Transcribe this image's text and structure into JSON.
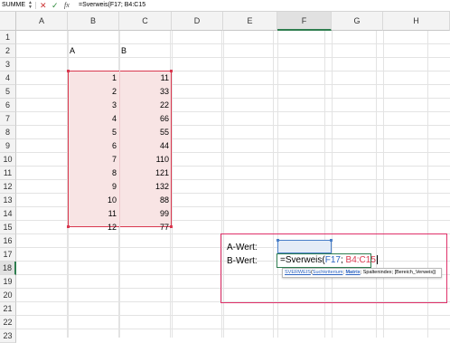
{
  "formula_bar": {
    "name_box": "SUMME",
    "cancel_icon": "x-icon",
    "enter_icon": "check-icon",
    "fx_label": "fx",
    "content": "=Sverweis(F17; B4:C15"
  },
  "columns": [
    "A",
    "B",
    "C",
    "D",
    "E",
    "F",
    "G",
    "H"
  ],
  "active_column": "F",
  "rows": [
    "1",
    "2",
    "3",
    "4",
    "5",
    "6",
    "7",
    "8",
    "9",
    "10",
    "11",
    "12",
    "13",
    "14",
    "15",
    "16",
    "17",
    "18",
    "19",
    "20",
    "21",
    "22",
    "23"
  ],
  "active_row": "18",
  "headers": {
    "b2": "A",
    "c2": "B"
  },
  "table": {
    "b": [
      "1",
      "2",
      "3",
      "4",
      "5",
      "6",
      "7",
      "8",
      "9",
      "10",
      "11",
      "12"
    ],
    "c": [
      "11",
      "33",
      "22",
      "66",
      "55",
      "44",
      "110",
      "121",
      "132",
      "88",
      "99",
      "77"
    ]
  },
  "labels": {
    "e17": "A-Wert:",
    "e18": "B-Wert:"
  },
  "edit_cell": {
    "prefix": "=Sverweis(",
    "ref1": "F17",
    "sep": "; ",
    "ref2": "B4:C15"
  },
  "tooltip": {
    "fn": "SVERWEIS",
    "open": "(",
    "arg1": "Suchkriterium",
    "sep1": "; ",
    "arg2": "Matrix",
    "rest": "; Spaltenindex; [Bereich_Verweis])"
  },
  "colors": {
    "range_border": "#d9384f",
    "range_fill": "#f8e4e4",
    "ref_blue": "#2b62c0",
    "annotation_border": "#e0306a",
    "active_green": "#2e7d4f"
  }
}
